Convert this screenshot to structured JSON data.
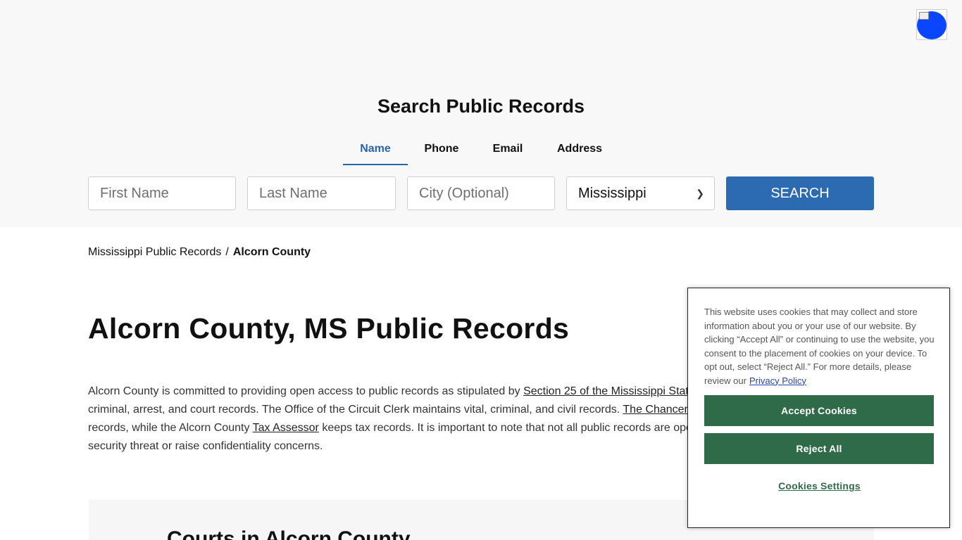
{
  "search": {
    "title": "Search Public Records",
    "tabs": [
      {
        "label": "Name",
        "active": true
      },
      {
        "label": "Phone",
        "active": false
      },
      {
        "label": "Email",
        "active": false
      },
      {
        "label": "Address",
        "active": false
      }
    ],
    "first_name_placeholder": "First Name",
    "last_name_placeholder": "Last Name",
    "city_placeholder": "City (Optional)",
    "state_selected": "Mississippi",
    "button_label": "SEARCH"
  },
  "breadcrumb": {
    "parent": "Mississippi Public Records",
    "separator": "/",
    "current": "Alcorn County"
  },
  "page": {
    "title": "Alcorn County, MS Public Records",
    "intro": {
      "line1_text": "Alcorn County is committed to providing open access to public records as stipulated by ",
      "line1_link": "Section 25 of the Mississippi Stat",
      "line2_text": "criminal, arrest, and court records. The Office of the Circuit Clerk maintains vital, criminal, and civil records. ",
      "line2_link": "The Chancer",
      "line3_text_a": "records, while the Alcorn County ",
      "line3_link": "Tax Assessor",
      "line3_text_b": " keeps tax records. It is important to note that not all public records are ope",
      "line4_text": "security threat or raise confidentiality concerns."
    },
    "courts_heading_prefix": "Courts in ",
    "courts_heading_bold": "Alcorn",
    "courts_heading_suffix": " County"
  },
  "cookie": {
    "message": "This website uses cookies that may collect and store information about you or your use of our website. By clicking “Accept All” or continuing to use the website, you consent to the placement of cookies on your device. To opt out, select “Reject All.” For more details, please review our",
    "policy_link": "Privacy Policy",
    "accept_label": "Accept Cookies",
    "reject_label": "Reject All",
    "settings_label": "Cookies Settings"
  },
  "colors": {
    "accent_blue": "#2c6ab2",
    "cookie_green": "#306b49",
    "avatar_blue": "#0a46ff"
  }
}
